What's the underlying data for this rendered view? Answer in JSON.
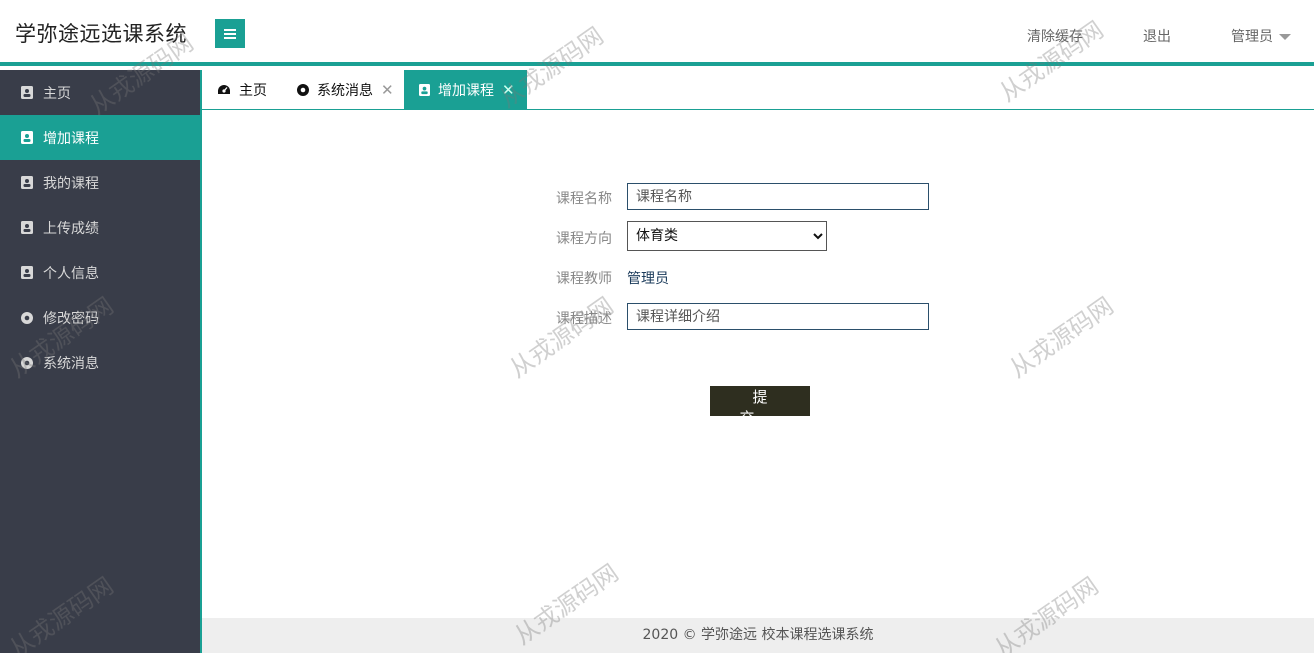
{
  "header": {
    "title": "学弥途远选课系统",
    "clear_cache": "清除缓存",
    "logout": "退出",
    "user": "管理员"
  },
  "sidebar": {
    "items": [
      {
        "label": "主页",
        "icon": "contact-card-icon"
      },
      {
        "label": "增加课程",
        "icon": "contact-card-icon",
        "active": true
      },
      {
        "label": "我的课程",
        "icon": "contact-card-icon"
      },
      {
        "label": "上传成绩",
        "icon": "contact-card-icon"
      },
      {
        "label": "个人信息",
        "icon": "contact-card-icon"
      },
      {
        "label": "修改密码",
        "icon": "circle-dot-icon"
      },
      {
        "label": "系统消息",
        "icon": "circle-dot-icon"
      }
    ]
  },
  "tabs": [
    {
      "label": "主页",
      "icon": "dashboard-icon"
    },
    {
      "label": "系统消息",
      "icon": "circle-dot-icon",
      "closable": true
    },
    {
      "label": "增加课程",
      "icon": "contact-card-icon",
      "closable": true,
      "active": true
    }
  ],
  "form": {
    "name_label": "课程名称",
    "name_placeholder": "课程名称",
    "direction_label": "课程方向",
    "direction_value": "体育类",
    "teacher_label": "课程教师",
    "teacher_value": "管理员",
    "desc_label": "课程描述",
    "desc_placeholder": "课程详细介绍",
    "submit_label": "提交"
  },
  "footer": {
    "text": "2020 ©  学弥途远  校本课程选课系统"
  },
  "watermark": {
    "text": "从戎源码网"
  },
  "colors": {
    "accent": "#1aa094",
    "sidebar_bg": "#393d49",
    "button_bg": "#2e2e1f"
  }
}
